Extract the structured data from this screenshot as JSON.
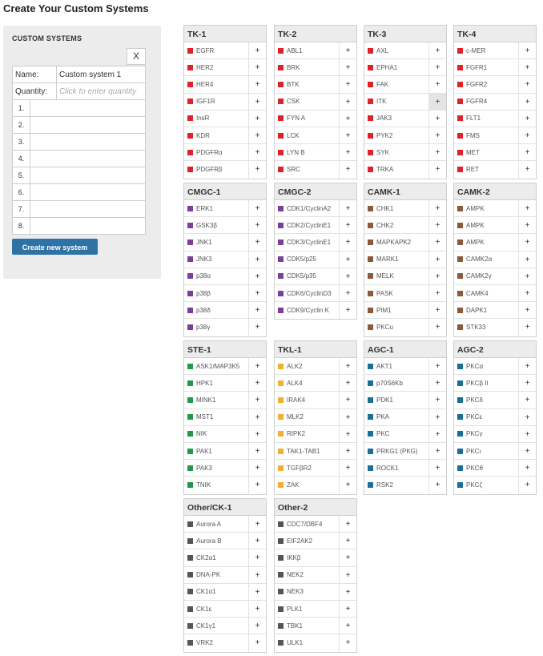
{
  "page_title": "Create Your Custom Systems",
  "sidebar": {
    "title": "CUSTOM SYSTEMS",
    "close_label": "X",
    "name_label": "Name:",
    "name_value": "Custom system 1",
    "quantity_label": "Quantity:",
    "quantity_placeholder": "Click to enter quantity",
    "slots": [
      "1.",
      "2.",
      "3.",
      "4.",
      "5.",
      "6.",
      "7.",
      "8."
    ],
    "create_button": "Create new system"
  },
  "add_symbol": "+",
  "colors": {
    "TK": "#e0202a",
    "CMGC": "#7b3f9b",
    "CAMK": "#8a5a3c",
    "STE": "#1e9a4a",
    "TKL": "#f0b030",
    "AGC": "#1a6e99",
    "Other": "#555555"
  },
  "groups": [
    {
      "title": "TK-1",
      "family": "TK",
      "items": [
        "EGFR",
        "HER2",
        "HER4",
        "IGF1R",
        "InsR",
        "KDR",
        "PDGFRα",
        "PDGFRβ"
      ]
    },
    {
      "title": "TK-2",
      "family": "TK",
      "items": [
        "ABL1",
        "BRK",
        "BTK",
        "CSK",
        "FYN A",
        "LCK",
        "LYN B",
        "SRC"
      ]
    },
    {
      "title": "TK-3",
      "family": "TK",
      "items": [
        "AXL",
        "EPHA1",
        "FAK",
        "ITK",
        "JAK3",
        "PYK2",
        "SYK",
        "TRKA"
      ]
    },
    {
      "title": "TK-4",
      "family": "TK",
      "items": [
        "c-MER",
        "FGFR1",
        "FGFR2",
        "FGFR4",
        "FLT1",
        "FMS",
        "MET",
        "RET"
      ]
    },
    {
      "title": "CMGC-1",
      "family": "CMGC",
      "items": [
        "ERK1",
        "GSK3β",
        "JNK1",
        "JNK3",
        "p38α",
        "p38β",
        "p38δ",
        "p38γ"
      ]
    },
    {
      "title": "CMGC-2",
      "family": "CMGC",
      "items": [
        "CDK1/CyclinA2",
        "CDK2/CyclinE1",
        "CDK3/CyclinE1",
        "CDK5/p25",
        "CDK5/p35",
        "CDK6/CyclinD3",
        "CDK9/Cyclin K"
      ]
    },
    {
      "title": "CAMK-1",
      "family": "CAMK",
      "items": [
        "CHK1",
        "CHK2",
        "MAPKAPK2",
        "MARK1",
        "MELK",
        "PASK",
        "PIM1",
        "PKCu"
      ]
    },
    {
      "title": "CAMK-2",
      "family": "CAMK",
      "items": [
        "AMPK",
        "AMPK",
        "AMPK",
        "CAMK2α",
        "CAMK2γ",
        "CAMK4",
        "DAPK1",
        "STK33"
      ]
    },
    {
      "title": "STE-1",
      "family": "STE",
      "items": [
        "ASK1/MAP3K5",
        "HPK1",
        "MINK1",
        "MST1",
        "NIK",
        "PAK1",
        "PAK3",
        "TNIK"
      ]
    },
    {
      "title": "TKL-1",
      "family": "TKL",
      "items": [
        "ALK2",
        "ALK4",
        "IRAK4",
        "MLK2",
        "RIPK2",
        "TAK1-TAB1",
        "TGFβR2",
        "ZAK"
      ]
    },
    {
      "title": "AGC-1",
      "family": "AGC",
      "items": [
        "AKT1",
        "p70S6Kb",
        "PDK1",
        "PKA",
        "PKC",
        "PRKG1 (PKG)",
        "ROCK1",
        "RSK2"
      ]
    },
    {
      "title": "AGC-2",
      "family": "AGC",
      "items": [
        "PKCα",
        "PKCβ II",
        "PKCδ",
        "PKCε",
        "PKCγ",
        "PKCι",
        "PKCθ",
        "PKCζ"
      ]
    },
    {
      "title": "Other/CK-1",
      "family": "Other",
      "items": [
        "Aurora A",
        "Aurora B",
        "CK2α1",
        "DNA-PK",
        "CK1α1",
        "CK1ε",
        "CK1γ1",
        "VRK2"
      ]
    },
    {
      "title": "Other-2",
      "family": "Other",
      "items": [
        "CDC7/DBF4",
        "EIF2AK2",
        "IKKβ",
        "NEK2",
        "NEK3",
        "PLK1",
        "TBK1",
        "ULK1"
      ]
    }
  ]
}
